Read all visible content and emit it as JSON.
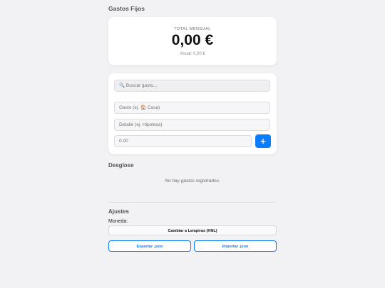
{
  "app": {
    "title": "Gastos Fijos"
  },
  "summary": {
    "label": "TOTAL MENSUAL",
    "amount": "0,00 €",
    "annual": "Anual: 0,00 €"
  },
  "form": {
    "search_placeholder": "🔍 Buscar gasto...",
    "name_placeholder": "Gasto (ej. 🏠 Casa)",
    "detail_placeholder": "Detalle (ej. Hipoteca)",
    "amount_placeholder": "0.00",
    "add_label": "+"
  },
  "breakdown": {
    "title": "Desglose",
    "empty_text": "No hay gastos registrados."
  },
  "settings": {
    "title": "Ajustes",
    "currency_label": "Moneda:",
    "change_currency_label": "Cambiar a Lempiras (HNL)",
    "export_label": "Exportar .json",
    "import_label": "Importar .json"
  },
  "colors": {
    "accent": "#0a7cff",
    "background": "#f2f2f4"
  }
}
